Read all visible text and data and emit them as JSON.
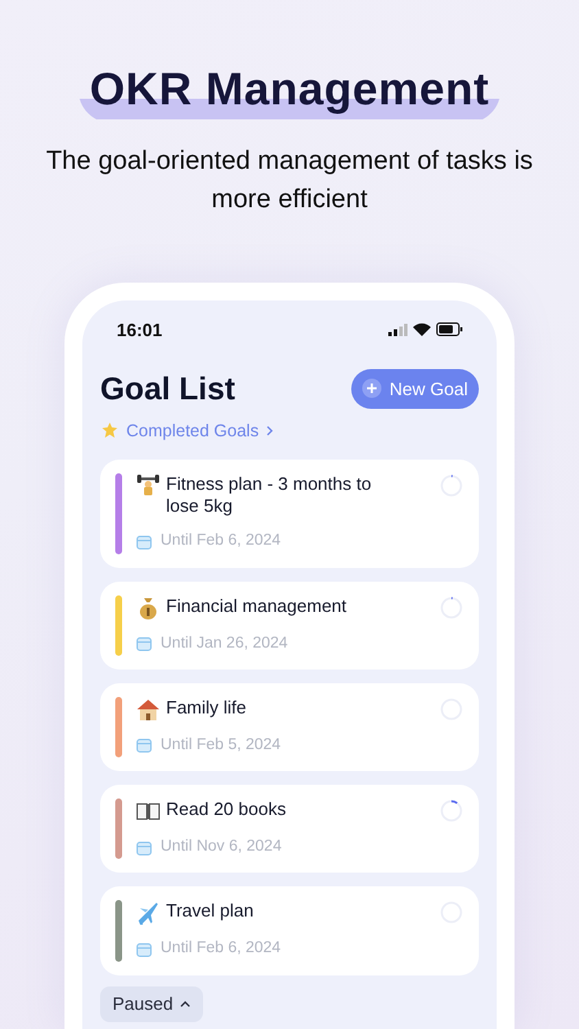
{
  "headline": "OKR Management",
  "subtitle": "The goal-oriented management of tasks is more efficient",
  "status_bar": {
    "time": "16:01"
  },
  "header": {
    "title": "Goal List",
    "new_button": "New Goal",
    "completed_link": "Completed Goals"
  },
  "goals": [
    {
      "title": "Fitness plan - 3 months to lose 5kg",
      "due": "Until Feb 6, 2024",
      "color": "#b57ee8",
      "level": 0.02
    },
    {
      "title": "Financial management",
      "due": "Until Jan 26, 2024",
      "color": "#f6cf4a",
      "level": 0.02
    },
    {
      "title": "Family life",
      "due": "Until Feb 5, 2024",
      "color": "#f2a07a",
      "level": 0
    },
    {
      "title": "Read 20 books",
      "due": "Until Nov 6, 2024",
      "color": "#d49a8f",
      "level": 0.1
    },
    {
      "title": "Travel plan",
      "due": "Until Feb 6, 2024",
      "color": "#8a9588",
      "level": 0
    }
  ],
  "section_toggle": {
    "label": "Paused",
    "expanded": true
  }
}
